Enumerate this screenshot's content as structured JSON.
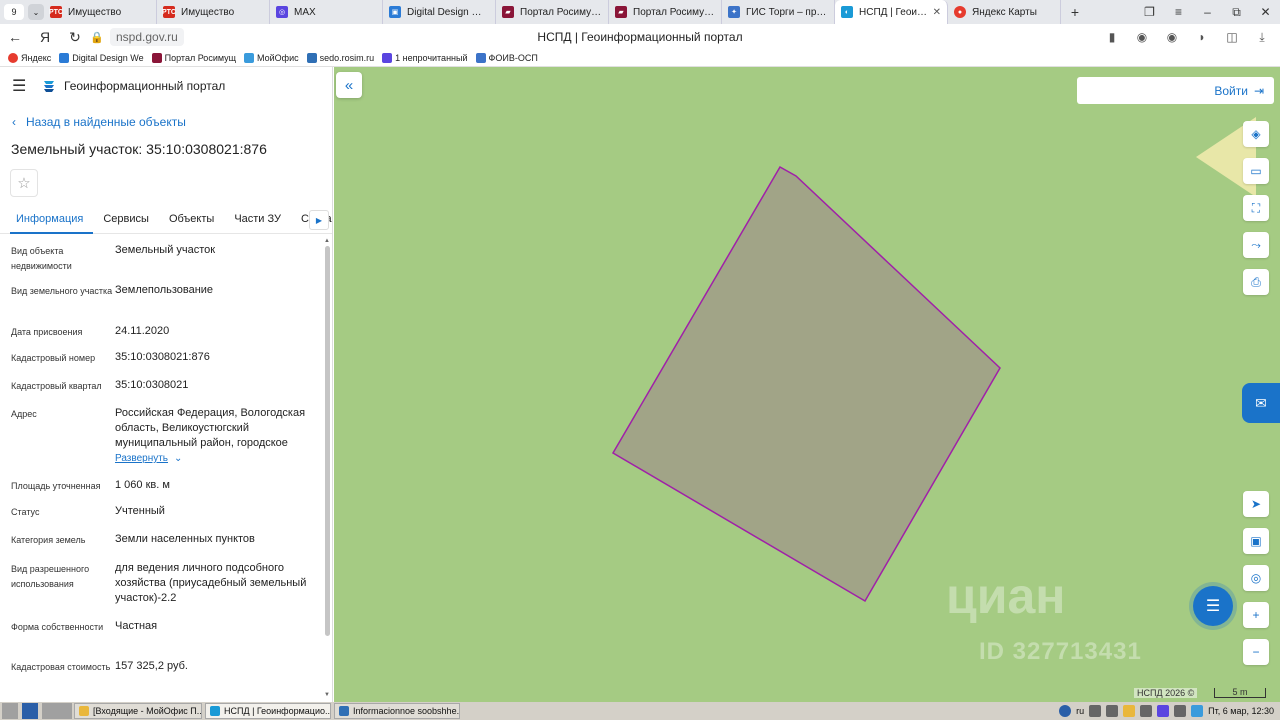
{
  "browser": {
    "tab_counter": "9",
    "tabs": [
      {
        "label": "Имущество",
        "icon": "rts-icon"
      },
      {
        "label": "Имущество",
        "icon": "rts-icon"
      },
      {
        "label": "MAX",
        "icon": "max-icon"
      },
      {
        "label": "Digital Design Web C",
        "icon": "dd-icon"
      },
      {
        "label": "Портал Росимущест",
        "icon": "portal-icon"
      },
      {
        "label": "Портал Росимущест",
        "icon": "portal-icon"
      },
      {
        "label": "ГИС Торги – продаж",
        "icon": "gis-icon"
      },
      {
        "label": "НСПД | Геоинфор",
        "icon": "nspd-icon",
        "active": true
      },
      {
        "label": "Яндекс Карты",
        "icon": "ymaps-icon"
      }
    ],
    "url": "nspd.gov.ru",
    "page_title": "НСПД | Геоинформационный портал",
    "bookmarks": [
      "Яндекс",
      "Digital Design We",
      "Портал Росимущ",
      "МойОфис",
      "sedo.rosim.ru",
      "1 непрочитанный",
      "ФОИВ-ОСП"
    ]
  },
  "panel": {
    "portal_name": "Геоинформационный портал",
    "back_link": "Назад в найденные объекты",
    "object_title": "Земельный участок: 35:10:0308021:876",
    "tabs": [
      "Информация",
      "Сервисы",
      "Объекты",
      "Части ЗУ",
      "Состав"
    ],
    "info_rows": [
      {
        "label": "Вид объекта недвижимости",
        "value": "Земельный участок"
      },
      {
        "label": "Вид земельного участка",
        "value": "Землепользование"
      },
      {
        "label": "Дата присвоения",
        "value": "24.11.2020"
      },
      {
        "label": "Кадастровый номер",
        "value": "35:10:0308021:876"
      },
      {
        "label": "Кадастровый квартал",
        "value": "35:10:0308021"
      },
      {
        "label": "Адрес",
        "value": "Российская Федерация, Вологодская область, Великоустюгский муниципальный район, городское"
      },
      {
        "label": "Площадь уточненная",
        "value": "1 060 кв. м"
      },
      {
        "label": "Статус",
        "value": "Учтенный"
      },
      {
        "label": "Категория земель",
        "value": "Земли населенных пунктов"
      },
      {
        "label": "Вид разрешенного использования",
        "value": "для ведения личного подсобного хозяйства (приусадебный земельный участок)-2.2"
      },
      {
        "label": "Форма собственности",
        "value": "Частная"
      },
      {
        "label": "Кадастровая стоимость",
        "value": "157 325,2 руб."
      }
    ],
    "expand_label": "Развернуть"
  },
  "map": {
    "login_label": "Войти",
    "watermark": "циан",
    "watermark_id": "ID 327713431",
    "attribution": "НСПД 2026 ©",
    "scale_label": "5 m",
    "colors": {
      "background": "#a5cb83",
      "parcel_fill": "#a1a487",
      "parcel_stroke": "#a020a8",
      "accent": "#1a73c9"
    }
  },
  "taskbar": {
    "apps": [
      "[Входящие - МойОфис П...",
      "НСПД | Геоинформацио...",
      "Informacionnoe soobshhe..."
    ],
    "lang": "ru",
    "clock": "Пт, 6 мар, 12:30"
  }
}
